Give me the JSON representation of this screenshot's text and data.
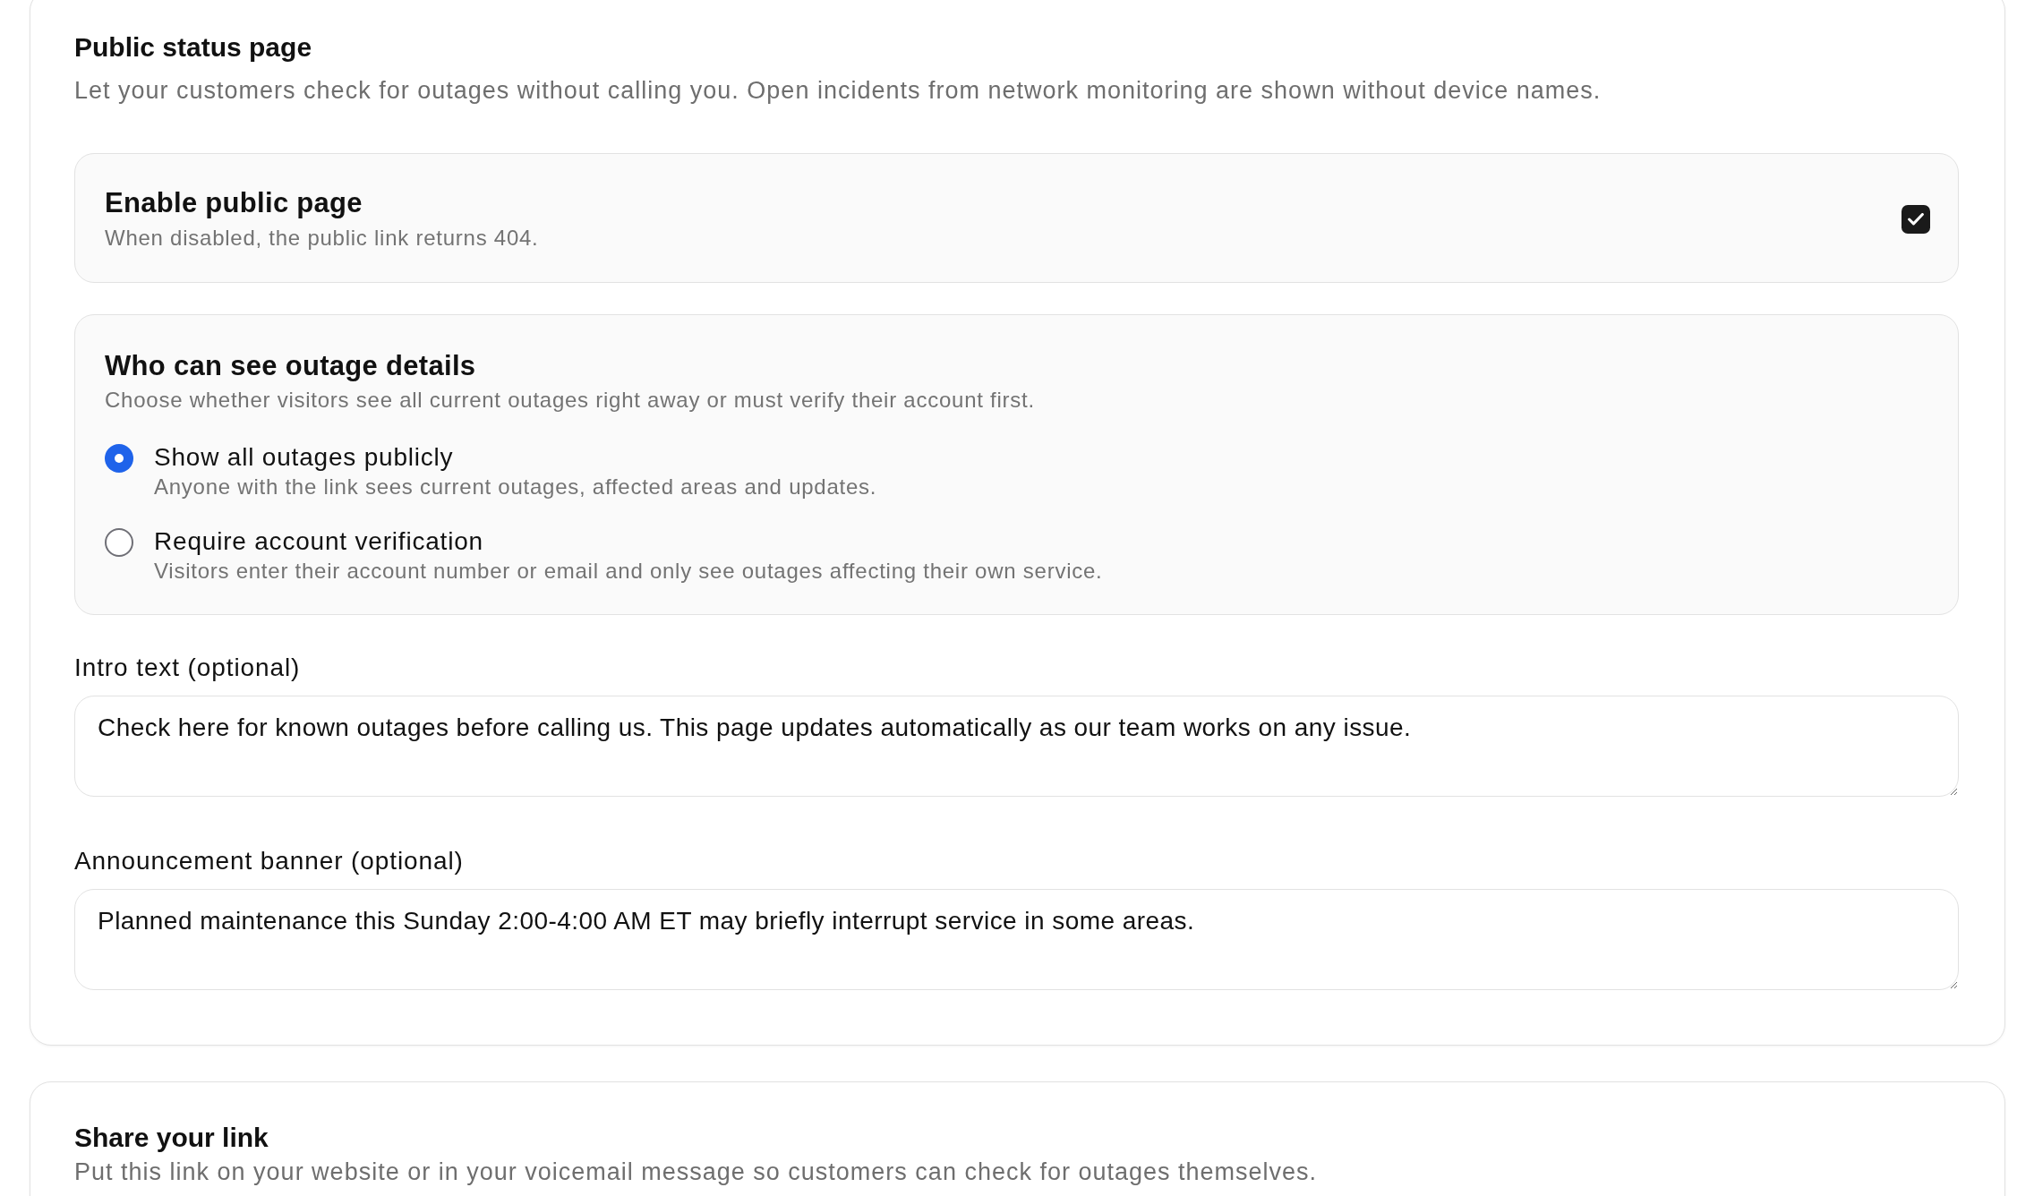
{
  "status_page": {
    "title": "Public status page",
    "description": "Let your customers check for outages without calling you. Open incidents from network monitoring are shown without device names.",
    "enable_option": {
      "title": "Enable public page",
      "description": "When disabled, the public link returns 404.",
      "checked": true
    },
    "visibility": {
      "title": "Who can see outage details",
      "description": "Choose whether visitors see all current outages right away or must verify their account first.",
      "options": [
        {
          "label": "Show all outages publicly",
          "description": "Anyone with the link sees current outages, affected areas and updates.",
          "selected": true
        },
        {
          "label": "Require account verification",
          "description": "Visitors enter their account number or email and only see outages affecting their own service.",
          "selected": false
        }
      ]
    },
    "fields": [
      {
        "label": "Intro text (optional)",
        "value": "Check here for known outages before calling us. This page updates automatically as our team works on any issue."
      },
      {
        "label": "Announcement banner (optional)",
        "value": "Planned maintenance this Sunday 2:00-4:00 AM ET may briefly interrupt service in some areas."
      }
    ]
  },
  "share_link": {
    "title": "Share your link",
    "description": "Put this link on your website or in your voicemail message so customers can check for outages themselves."
  }
}
